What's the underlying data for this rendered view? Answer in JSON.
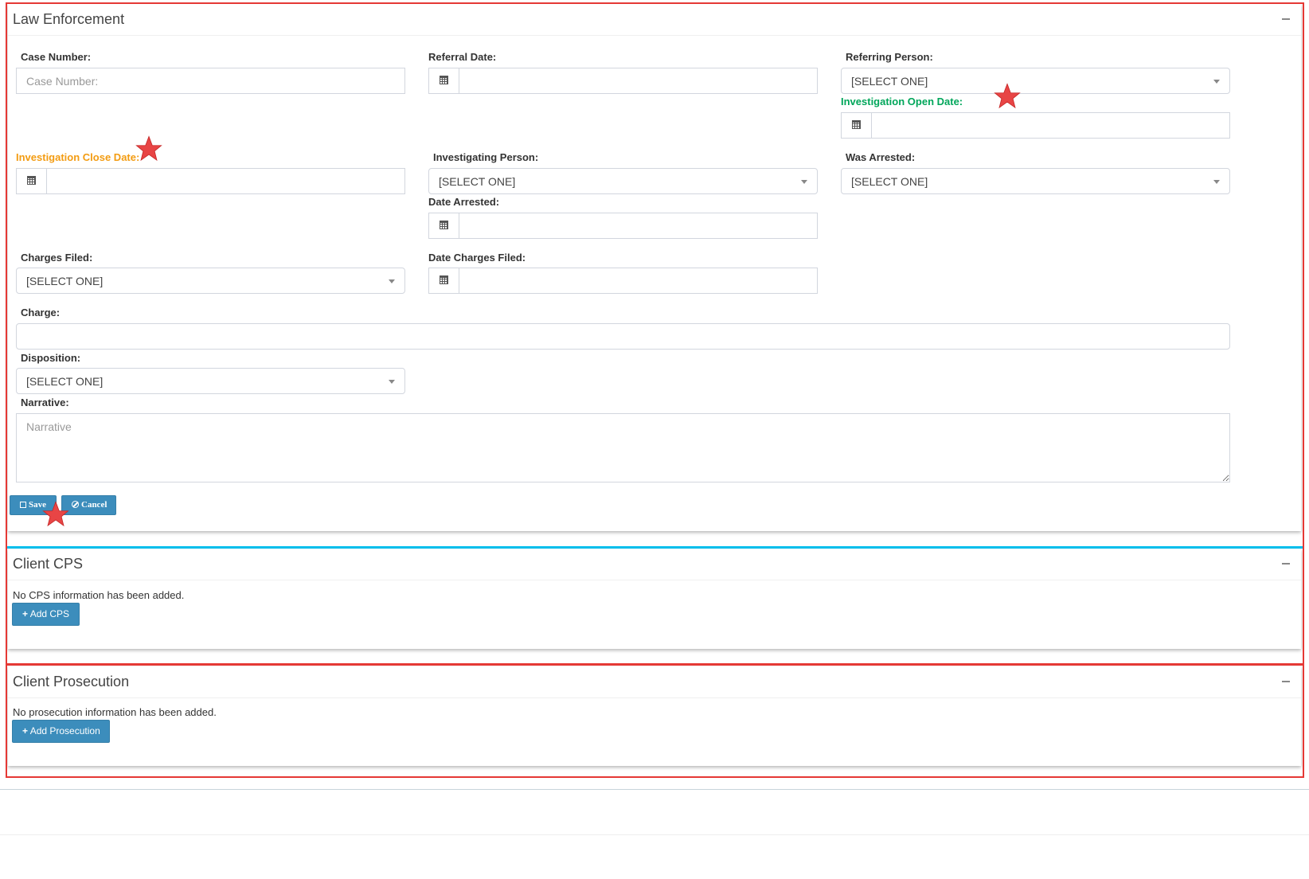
{
  "law_enforcement": {
    "title": "Law Enforcement",
    "case_number_label": "Case Number:",
    "case_number_placeholder": "Case Number:",
    "referral_date_label": "Referral Date:",
    "referring_person_label": "Referring Person:",
    "referring_person_value": "[SELECT ONE]",
    "investigation_open_date_label": "Investigation Open Date:",
    "investigation_close_date_label": "Investigation Close Date:",
    "investigating_person_label": "Investigating Person:",
    "investigating_person_value": "[SELECT ONE]",
    "was_arrested_label": "Was Arrested:",
    "was_arrested_value": "[SELECT ONE]",
    "date_arrested_label": "Date Arrested:",
    "charges_filed_label": "Charges Filed:",
    "charges_filed_value": "[SELECT ONE]",
    "date_charges_filed_label": "Date Charges Filed:",
    "charge_label": "Charge:",
    "disposition_label": "Disposition:",
    "disposition_value": "[SELECT ONE]",
    "narrative_label": "Narrative:",
    "narrative_placeholder": "Narrative",
    "save_label": "Save",
    "cancel_label": "Cancel"
  },
  "client_cps": {
    "title": "Client CPS",
    "empty_message": "No CPS information has been added.",
    "add_label": "Add CPS"
  },
  "client_prosecution": {
    "title": "Client Prosecution",
    "empty_message": "No prosecution information has been added.",
    "add_label": "Add Prosecution"
  },
  "colors": {
    "primary": "#3c8dbc",
    "warning_label": "#f39c12",
    "success_label": "#00a65a",
    "annotation": "#e53935",
    "divider": "#00c0ef"
  },
  "icons": {
    "calendar": "calendar-icon",
    "save": "floppy-icon",
    "cancel": "ban-icon",
    "add": "plus-icon",
    "collapse": "minus-icon",
    "annotation": "star-marker"
  }
}
